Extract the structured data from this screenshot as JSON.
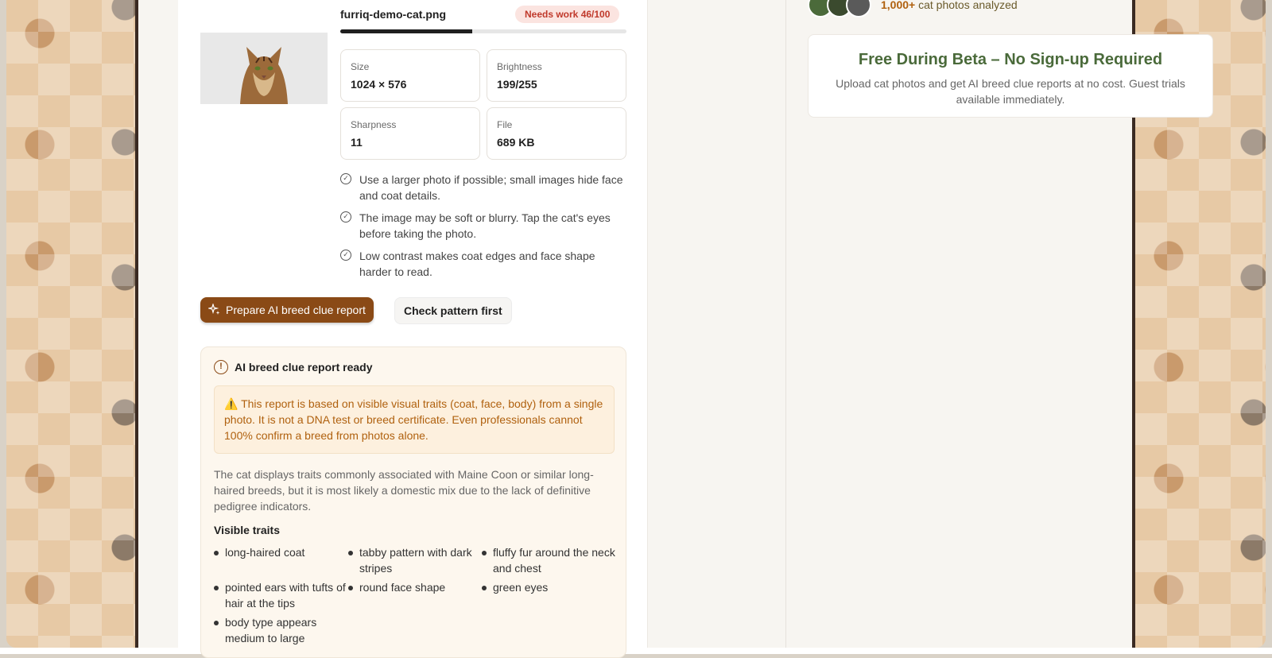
{
  "file": {
    "name": "furriq-demo-cat.png",
    "badge": "Needs work 46/100",
    "score_fraction": 0.46
  },
  "stats": [
    {
      "label": "Size",
      "value": "1024 × 576"
    },
    {
      "label": "Brightness",
      "value": "199/255"
    },
    {
      "label": "Sharpness",
      "value": "11"
    },
    {
      "label": "File",
      "value": "689 KB"
    }
  ],
  "tips": [
    "Use a larger photo if possible; small images hide face and coat details.",
    "The image may be soft or blurry. Tap the cat's eyes before taking the photo.",
    "Low contrast makes coat edges and face shape harder to read."
  ],
  "actions": {
    "primary": "Prepare AI breed clue report",
    "secondary": "Check pattern first"
  },
  "report": {
    "title": "AI breed clue report ready",
    "warning": "⚠️ This report is based on visible visual traits (coat, face, body) from a single photo. It is not a DNA test or breed certificate. Even professionals cannot 100% confirm a breed from photos alone.",
    "summary": "The cat displays traits commonly associated with Maine Coon or similar long-haired breeds, but it is most likely a domestic mix due to the lack of definitive pedigree indicators.",
    "visible_traits_title": "Visible traits",
    "traits": [
      "long-haired coat",
      "tabby pattern with dark stripes",
      "fluffy fur around the neck and chest",
      "pointed ears with tufts of hair at the tips",
      "round face shape",
      "green eyes",
      "body type appears medium to large"
    ]
  },
  "social_proof": {
    "count": "1,000+",
    "text": "cat photos analyzed"
  },
  "beta": {
    "title": "Free During Beta – No Sign-up Required",
    "desc": "Upload cat photos and get AI breed clue reports at no cost. Guest trials available immediately."
  },
  "colors": {
    "accent": "#8a4a16",
    "badge_bg": "#fbe4e0",
    "badge_text": "#c0392b",
    "beta_title": "#4a6a3a"
  }
}
